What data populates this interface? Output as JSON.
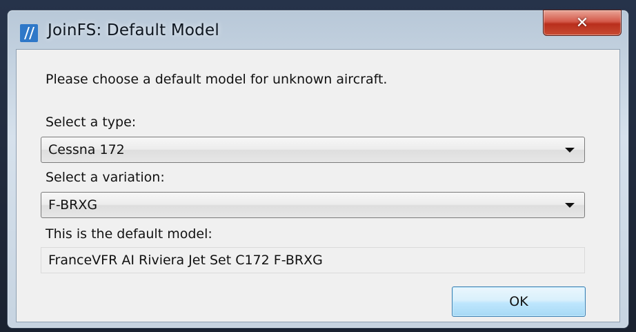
{
  "window": {
    "title": "JoinFS: Default Model",
    "close_glyph": "✕",
    "app_icon": "joinfs-logo-icon"
  },
  "dialog": {
    "prompt": "Please choose a default model for unknown aircraft.",
    "type_label": "Select a type:",
    "type_value": "Cessna 172",
    "variation_label": "Select a variation:",
    "variation_value": "F-BRXG",
    "model_label": "This is the default model:",
    "model_value": "FranceVFR AI Riviera Jet Set C172 F-BRXG",
    "ok_label": "OK"
  },
  "colors": {
    "close_button": "#c84c33",
    "ok_button_border": "#3c7fb1",
    "client_background": "#f0f0f0"
  }
}
